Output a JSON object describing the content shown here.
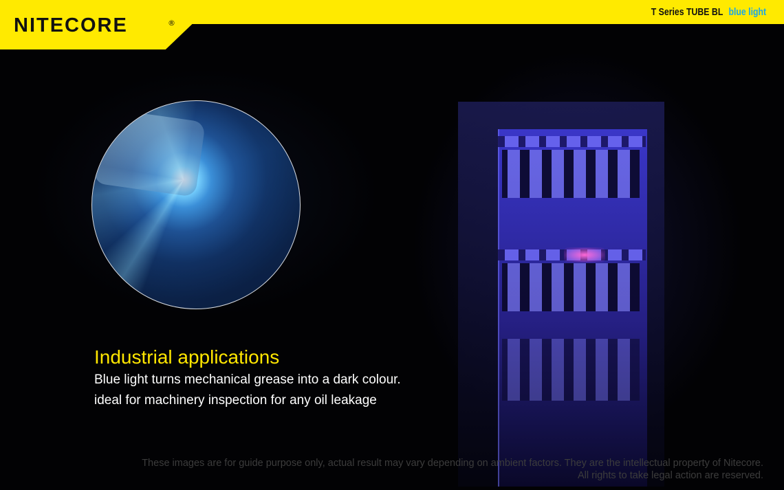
{
  "header": {
    "brand": "NITECORE",
    "registered_mark": "®",
    "product_series": "T Series",
    "product_name": "TUBE BL",
    "product_variant": "blue light"
  },
  "feature": {
    "title": "Industrial applications",
    "lines": [
      "Blue light turns mechanical grease into a dark colour.",
      "ideal for machinery inspection for any oil leakage"
    ]
  },
  "disclaimer": {
    "line1": "These images are for guide purpose only, actual result may vary depending on ambient factors. They are the intellectual property of Nitecore.",
    "line2": "All rights to take legal action are reserved."
  },
  "colors": {
    "brand_yellow": "#ffea00",
    "title_yellow": "#ffe600",
    "accent_blue": "#1aa7e8"
  }
}
